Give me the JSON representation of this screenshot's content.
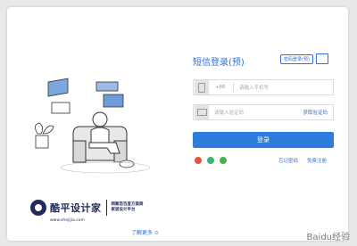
{
  "form": {
    "title": "短信登录(预)",
    "switch_tag": "密码登录(预)",
    "phone": {
      "country_code": "+86",
      "placeholder": "请输入手机号"
    },
    "code": {
      "placeholder": "请输入验证码",
      "get_code": "获取验证码"
    },
    "login_button": "登录",
    "forgot_password": "忘记密码",
    "register": "免费注册"
  },
  "brand": {
    "name": "酷平设计家",
    "slogan_line1": "网聚您百度方案商",
    "slogan_line2": "家居设计平台",
    "url": "www.shejijia.com"
  },
  "learn_more": "了解更多 ⊙",
  "watermark": "Baidu经验",
  "colors": {
    "accent": "#2f6fdb",
    "button": "#2e7cde",
    "brand": "#1e2b5c"
  }
}
